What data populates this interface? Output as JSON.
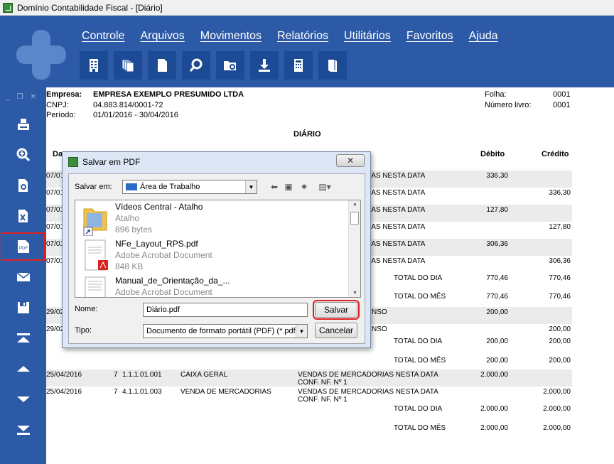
{
  "window": {
    "title": "Domínio Contabilidade Fiscal  - [Diário]"
  },
  "menu": [
    "Controle",
    "Arquivos",
    "Movimentos",
    "Relatórios",
    "Utilitários",
    "Favoritos",
    "Ajuda"
  ],
  "toolbar_icons": [
    "building-icon",
    "documents-icon",
    "page-icon",
    "search-icon",
    "folder-search-icon",
    "download-icon",
    "calculator-icon",
    "book-icon"
  ],
  "sidebar_icons": [
    "print-icon",
    "zoom-icon",
    "preview-icon",
    "excel-icon",
    "pdf-icon",
    "email-icon",
    "save-icon",
    "first-page-icon",
    "previous-page-icon",
    "next-page-icon",
    "last-page-icon"
  ],
  "sidebar": {
    "pdf_label": "PDF",
    "win_min": "_",
    "win_restore": "❐",
    "win_close": "✕"
  },
  "report": {
    "empresa_label": "Empresa:",
    "empresa_value": "EMPRESA EXEMPLO PRESUMIDO LTDA",
    "cnpj_label": "CNPJ:",
    "cnpj_value": "04.883.814/0001-72",
    "periodo_label": "Período:",
    "periodo_value": "01/01/2016 - 30/04/2016",
    "folha_label": "Folha:",
    "folha_value": "0001",
    "livro_label": "Número livro:",
    "livro_value": "0001",
    "title": "DIÁRIO",
    "col_data": "Da",
    "col_debito": "Débito",
    "col_credito": "Crédito",
    "rows": [
      {
        "date": "07/01",
        "desc": "DRIAS NESTA DATA",
        "debit": "336,30",
        "credit": "",
        "shade": true
      },
      {
        "date": "07/01",
        "desc": "DRIAS NESTA DATA",
        "debit": "",
        "credit": "336,30",
        "shade": false
      },
      {
        "date": "07/01",
        "desc": "DRIAS NESTA DATA",
        "debit": "127,80",
        "credit": "",
        "shade": true
      },
      {
        "date": "07/01",
        "desc": "DRIAS NESTA DATA",
        "debit": "",
        "credit": "127,80",
        "shade": false
      },
      {
        "date": "07/01",
        "desc": "DRIAS NESTA DATA",
        "debit": "306,36",
        "credit": "",
        "shade": true
      },
      {
        "date": "07/01",
        "desc": "DRIAS NESTA DATA",
        "debit": "",
        "credit": "306,36",
        "shade": false
      }
    ],
    "totals1": [
      {
        "label": "TOTAL DO DIA",
        "debit": "770,46",
        "credit": "770,46"
      },
      {
        "label": "TOTAL DO MÊS",
        "debit": "770,46",
        "credit": "770,46"
      }
    ],
    "rows2": [
      {
        "date": "29/02",
        "desc": "NSO",
        "debit": "200,00",
        "credit": ""
      },
      {
        "date": "29/02",
        "desc": "NSO",
        "debit": "",
        "credit": "200,00"
      }
    ],
    "totals2": [
      {
        "label": "TOTAL DO DIA",
        "debit": "200,00",
        "credit": "200,00"
      },
      {
        "label": "TOTAL DO MÊS",
        "debit": "200,00",
        "credit": "200,00"
      }
    ],
    "rows3": [
      {
        "date": "25/04/2016",
        "num": "7",
        "account": "1.1.1.01.001",
        "name": "CAIXA GERAL",
        "hist1": "VENDAS DE MERCADORIAS NESTA DATA",
        "hist2": "CONF. NF. Nº 1",
        "debit": "2.000,00",
        "credit": ""
      },
      {
        "date": "25/04/2016",
        "num": "7",
        "account": "4.1.1.01.003",
        "name": "VENDA DE MERCADORIAS",
        "hist1": "VENDAS DE MERCADORIAS NESTA DATA",
        "hist2": "CONF. NF. Nº 1",
        "debit": "",
        "credit": "2.000,00"
      }
    ],
    "totals3": [
      {
        "label": "TOTAL DO DIA",
        "debit": "2.000,00",
        "credit": "2.000,00"
      },
      {
        "label": "TOTAL DO MÊS",
        "debit": "2.000,00",
        "credit": "2.000,00"
      }
    ]
  },
  "dialog": {
    "title": "Salvar em PDF",
    "close": "✕",
    "save_in_label": "Salvar em:",
    "save_in_value": "Área de Trabalho",
    "files": [
      {
        "name": "Vídeos Central - Atalho",
        "type": "Atalho",
        "size": "896 bytes"
      },
      {
        "name": "NFe_Layout_RPS.pdf",
        "type": "Adobe Acrobat Document",
        "size": "848 KB"
      },
      {
        "name": "Manual_de_Orientação_da_...",
        "type": "Adobe Acrobat Document",
        "size": ""
      }
    ],
    "name_label": "Nome:",
    "name_value": "Diário.pdf",
    "type_label": "Tipo:",
    "type_value": "Documento de formato portátil (PDF) (*.pdf)",
    "save_button": "Salvar",
    "cancel_button": "Cancelar"
  }
}
